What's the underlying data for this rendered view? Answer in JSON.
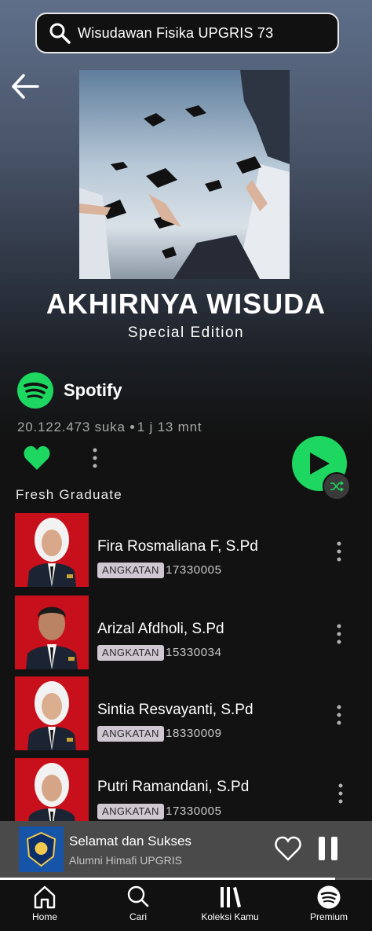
{
  "search": {
    "query": "Wisudawan Fisika UPGRIS 73"
  },
  "album": {
    "title": "AKHIRNYA WISUDA",
    "subtitle": "Special Edition"
  },
  "brand": {
    "name": "Spotify",
    "color": "#1ed760"
  },
  "stats": {
    "likes": "20.122.473 suka",
    "duration": "1 j 13 mnt"
  },
  "section_label": "Fresh Graduate",
  "tracks": [
    {
      "name": "Fira Rosmaliana F, S.Pd",
      "badge": "ANGKATAN",
      "nim": "17330005"
    },
    {
      "name": "Arizal Afdholi, S.Pd",
      "badge": "ANGKATAN",
      "nim": "15330034"
    },
    {
      "name": "Sintia Resvayanti, S.Pd",
      "badge": "ANGKATAN",
      "nim": "18330009"
    },
    {
      "name": "Putri Ramandani, S.Pd",
      "badge": "ANGKATAN",
      "nim": "17330005"
    }
  ],
  "now_playing": {
    "title": "Selamat dan Sukses",
    "artist": "Alumni Himafi UPGRIS",
    "progress": 0.9
  },
  "nav": [
    {
      "label": "Home",
      "icon": "home-icon"
    },
    {
      "label": "Cari",
      "icon": "search-icon"
    },
    {
      "label": "Koleksi Kamu",
      "icon": "library-icon"
    },
    {
      "label": "Premium",
      "icon": "spotify-icon"
    }
  ],
  "colors": {
    "accent": "#1ed760",
    "photo_bg": "#c8101c",
    "background": "#121212"
  }
}
